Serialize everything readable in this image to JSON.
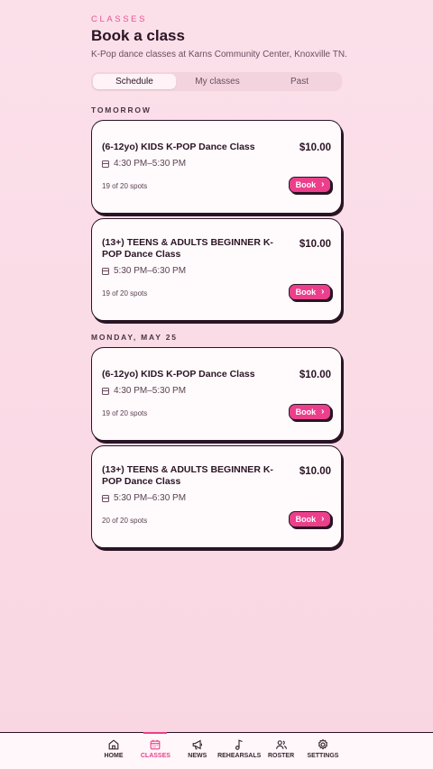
{
  "header": {
    "eyebrow": "CLASSES",
    "title": "Book a class",
    "subtitle": "K-Pop dance classes at Karns Community Center, Knoxville TN."
  },
  "tabs": [
    {
      "label": "Schedule",
      "active": true
    },
    {
      "label": "My classes",
      "active": false
    },
    {
      "label": "Past",
      "active": false
    }
  ],
  "sections": [
    {
      "label": "TOMORROW",
      "classes": [
        {
          "title": "(6-12yo) KIDS K-POP Dance Class",
          "price": "$10.00",
          "time": "4:30 PM–5:30 PM",
          "spots": "19 of 20 spots",
          "button": "Book"
        },
        {
          "title": "(13+) TEENS & ADULTS BEGINNER K-POP Dance Class",
          "price": "$10.00",
          "time": "5:30 PM–6:30 PM",
          "spots": "19 of 20 spots",
          "button": "Book"
        }
      ]
    },
    {
      "label": "MONDAY, MAY 25",
      "classes": [
        {
          "title": "(6-12yo) KIDS K-POP Dance Class",
          "price": "$10.00",
          "time": "4:30 PM–5:30 PM",
          "spots": "19 of 20 spots",
          "button": "Book"
        },
        {
          "title": "(13+) TEENS & ADULTS BEGINNER K-POP Dance Class",
          "price": "$10.00",
          "time": "5:30 PM–6:30 PM",
          "spots": "20 of 20 spots",
          "button": "Book"
        }
      ]
    }
  ],
  "nav": [
    {
      "label": "HOME",
      "icon": "home-icon"
    },
    {
      "label": "CLASSES",
      "icon": "calendar-icon",
      "active": true
    },
    {
      "label": "NEWS",
      "icon": "megaphone-icon"
    },
    {
      "label": "REHEARSALS",
      "icon": "music-note-icon"
    },
    {
      "label": "ROSTER",
      "icon": "users-icon"
    },
    {
      "label": "SETTINGS",
      "icon": "gear-icon"
    }
  ],
  "colors": {
    "accent": "#ec3f8b",
    "ink": "#2a1424",
    "background": "#fbe0ea"
  }
}
